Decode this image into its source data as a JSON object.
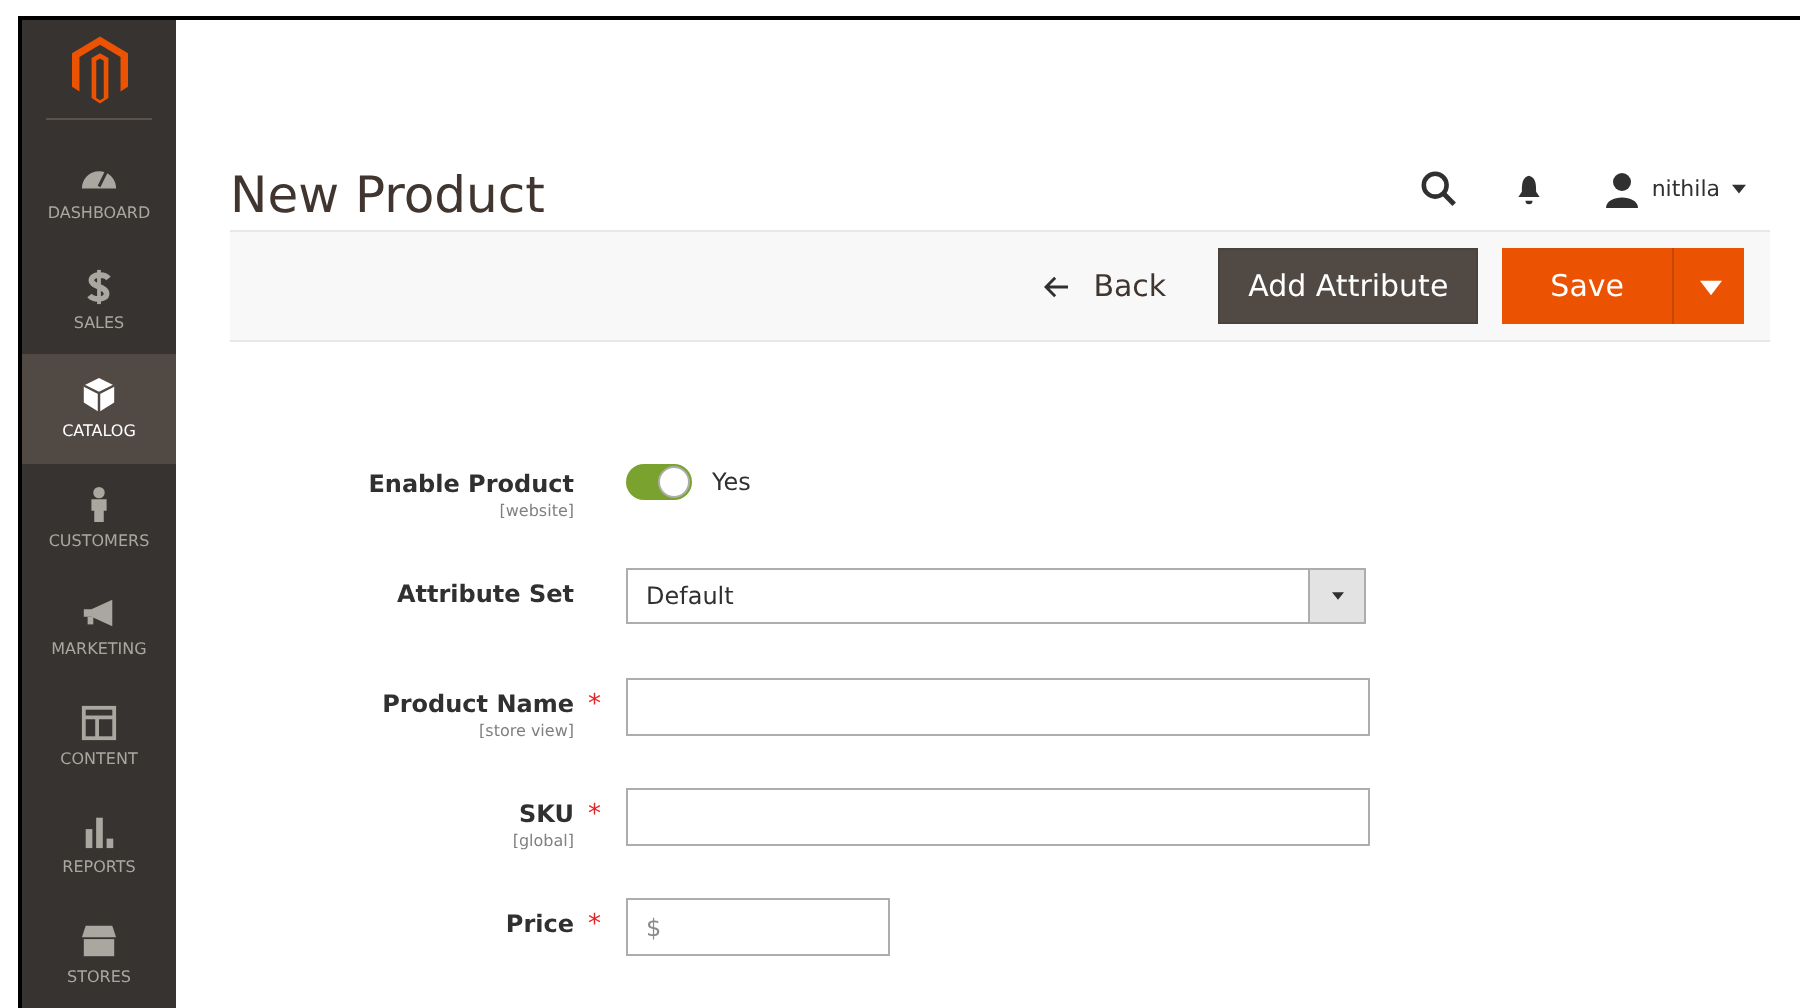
{
  "sidebar": {
    "items": [
      {
        "label": "DASHBOARD",
        "selected": false
      },
      {
        "label": "SALES",
        "selected": false
      },
      {
        "label": "CATALOG",
        "selected": true
      },
      {
        "label": "CUSTOMERS",
        "selected": false
      },
      {
        "label": "MARKETING",
        "selected": false
      },
      {
        "label": "CONTENT",
        "selected": false
      },
      {
        "label": "REPORTS",
        "selected": false
      },
      {
        "label": "STORES",
        "selected": false
      }
    ]
  },
  "header": {
    "title": "New Product",
    "user": "nithila"
  },
  "actions": {
    "back": "Back",
    "add_attribute": "Add Attribute",
    "save": "Save"
  },
  "form": [
    {
      "kind": "toggle",
      "label": "Enable Product",
      "scope": "[website]",
      "on": true,
      "value": "Yes"
    },
    {
      "kind": "select",
      "label": "Attribute Set",
      "value": "Default"
    },
    {
      "kind": "text",
      "label": "Product Name",
      "scope": "[store view]",
      "required_mark": "*"
    },
    {
      "kind": "text",
      "label": "SKU",
      "scope": "[global]",
      "required_mark": "*"
    },
    {
      "kind": "price",
      "label": "Price",
      "required_mark": "*",
      "placeholder": "$"
    }
  ]
}
